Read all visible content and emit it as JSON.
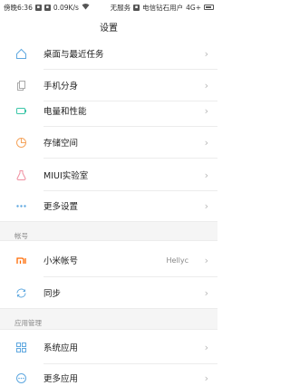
{
  "statusbar": {
    "left_time": "傍晚6:36",
    "left_icons": [
      "notification-icon",
      "grid-icon"
    ],
    "speed": "0.09K/s",
    "wifi_icon": "wifi-icon",
    "no_service": "无服务",
    "sim_box_icon": "sim-icon",
    "carrier": "电信钻石用户",
    "network": "4G+",
    "battery_icon": "battery-icon"
  },
  "header": {
    "title": "设置"
  },
  "groups": {
    "system": [
      {
        "label": "桌面与最近任务",
        "icon": "home-icon"
      },
      {
        "label": "手机分身",
        "icon": "phone-clone-icon"
      },
      {
        "label": "电量和性能",
        "icon": "battery-performance-icon"
      },
      {
        "label": "存储空间",
        "icon": "storage-icon"
      },
      {
        "label": "MIUI实验室",
        "icon": "lab-flask-icon"
      },
      {
        "label": "更多设置",
        "icon": "more-dots-icon"
      }
    ],
    "account_section": "帐号",
    "account": [
      {
        "label": "小米帐号",
        "icon": "mi-logo-icon",
        "value": "Hellyc"
      },
      {
        "label": "同步",
        "icon": "sync-icon"
      }
    ],
    "apps_section": "应用管理",
    "apps": [
      {
        "label": "系统应用",
        "icon": "grid-apps-icon"
      },
      {
        "label": "更多应用",
        "icon": "more-apps-icon"
      }
    ]
  },
  "chevron": "›",
  "colors": {
    "accent_orange": "#f5a45d",
    "icon_blue": "#5fa8e0",
    "mi_orange": "#ff6900"
  }
}
